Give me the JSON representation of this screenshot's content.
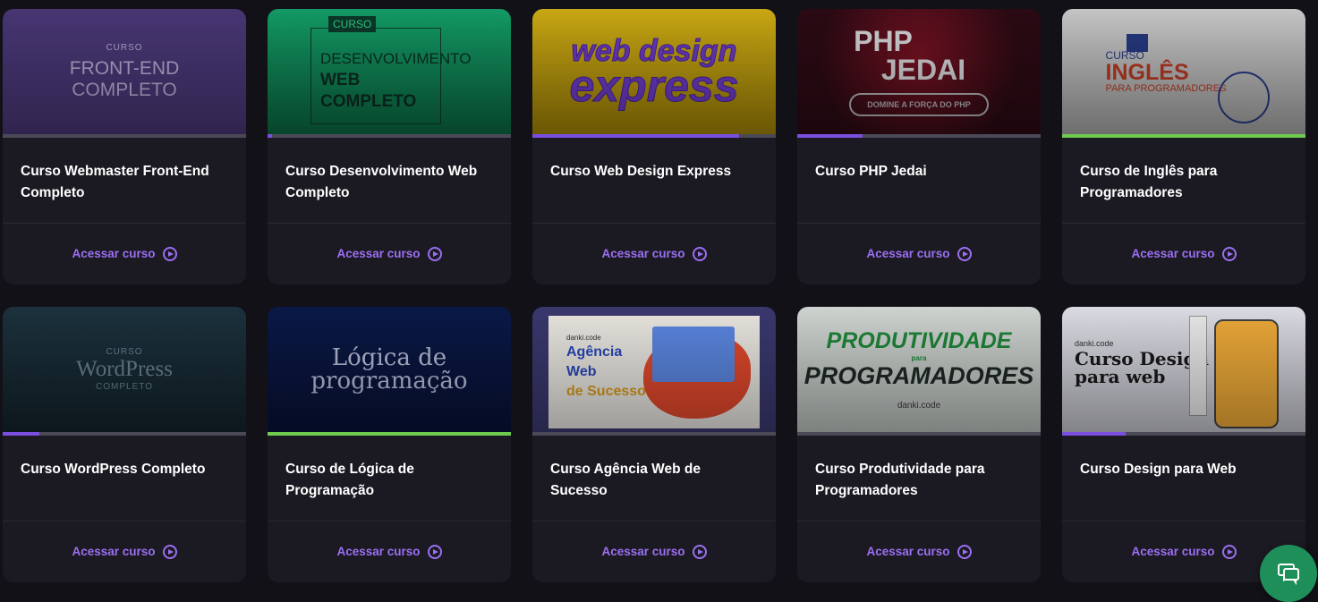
{
  "action_label": "Acessar curso",
  "colors": {
    "background": "#121118",
    "card": "#1b1a22",
    "accent": "#9b6ff2",
    "progress_purple": "#7a4fe0",
    "progress_green": "#6ecb4f",
    "progress_track": "#4c4957",
    "chat_button": "#1f8f5a"
  },
  "courses": [
    {
      "title": "Curso Webmaster Front-End Completo",
      "progress": 0,
      "progress_color": "#7a4fe0",
      "thumb": {
        "small": "CURSO",
        "line1": "FRONT-END",
        "line2": "COMPLETO"
      }
    },
    {
      "title": "Curso Desenvolvimento Web Completo",
      "progress": 0.02,
      "progress_color": "#7a4fe0",
      "thumb": {
        "tag": "CURSO",
        "line1": "DESENVOLVIMENTO",
        "line2": "WEB",
        "line3": "COMPLETO"
      }
    },
    {
      "title": "Curso Web Design Express",
      "progress": 0.85,
      "progress_color": "#7a4fe0",
      "thumb": {
        "line1": "web design",
        "line2": "express"
      }
    },
    {
      "title": "Curso PHP Jedai",
      "progress": 0.27,
      "progress_color": "#7a4fe0",
      "thumb": {
        "line1": "PHP",
        "line2": "JEDAI",
        "pill": "DOMINE A FORÇA DO PHP"
      }
    },
    {
      "title": "Curso de Inglês para Programadores",
      "progress": 1,
      "progress_color": "#6ecb4f",
      "thumb": {
        "small": "CURSO",
        "line1": "INGLÊS",
        "line2": "PARA PROGRAMADORES"
      }
    },
    {
      "title": "Curso WordPress Completo",
      "progress": 0.15,
      "progress_color": "#7a4fe0",
      "thumb": {
        "small": "CURSO",
        "line1": "WordPress",
        "line2": "COMPLETO"
      }
    },
    {
      "title": "Curso de Lógica de Programação",
      "progress": 1,
      "progress_color": "#6ecb4f",
      "thumb": {
        "line1": "Lógica de",
        "line2": "programação"
      }
    },
    {
      "title": "Curso Agência Web de Sucesso",
      "progress": 0,
      "progress_color": "#7a4fe0",
      "thumb": {
        "brand": "danki.code",
        "line1": "Agência",
        "line2": "Web",
        "line3": "de Sucesso"
      }
    },
    {
      "title": "Curso Produtividade para Programadores",
      "progress": 0,
      "progress_color": "#7a4fe0",
      "thumb": {
        "line1": "PRODUTIVIDADE",
        "line2": "para",
        "line3": "PROGRAMADORES",
        "brand": "danki.code"
      }
    },
    {
      "title": "Curso Design para Web",
      "progress": 0.26,
      "progress_color": "#7a4fe0",
      "thumb": {
        "brand": "danki.code",
        "line1": "Curso Design",
        "line2": "para web"
      }
    }
  ]
}
